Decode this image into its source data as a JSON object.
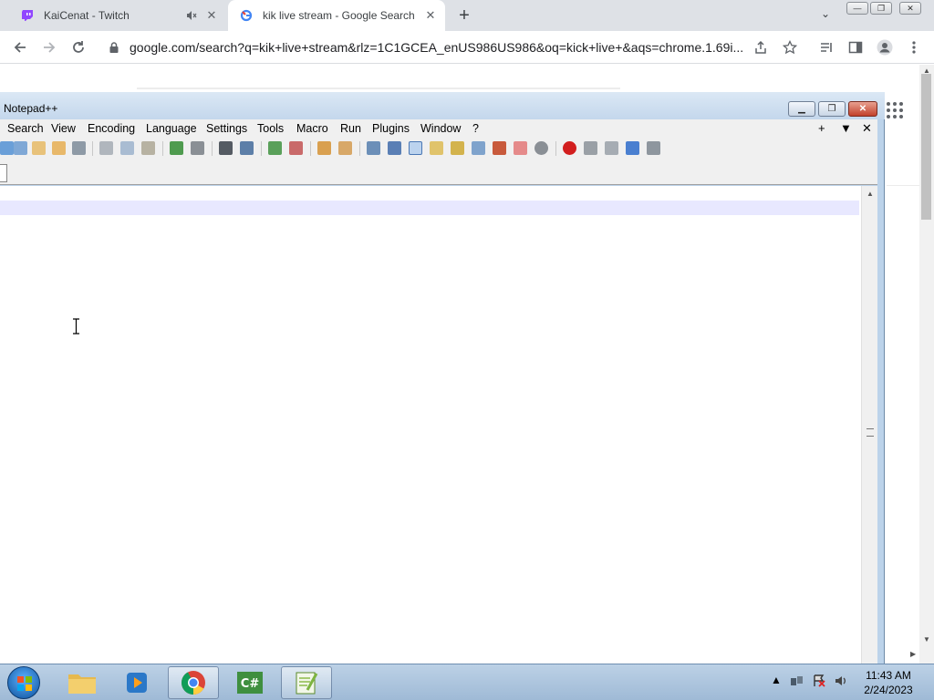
{
  "browser": {
    "tabs": [
      {
        "title": "KaiCenat - Twitch",
        "favicon": "twitch-icon",
        "muted": true
      },
      {
        "title": "kik live stream - Google Search",
        "favicon": "google-icon",
        "active": true
      }
    ],
    "new_tab": "+",
    "tab_close": "✕",
    "url": "google.com/search?q=kik+live+stream&rlz=1C1GCEA_enUS986US986&oq=kick+live+&aqs=chrome.1.69i..."
  },
  "notepadpp": {
    "title": "Notepad++",
    "menu": [
      "Search",
      "View",
      "Encoding",
      "Language",
      "Settings",
      "Tools",
      "Macro",
      "Run",
      "Plugins",
      "Window",
      "?"
    ],
    "menu_right": [
      "+",
      "▼",
      "✕"
    ]
  },
  "taskbar": {
    "apps": [
      "file-explorer-icon",
      "media-player-icon",
      "chrome-icon",
      "csharp-icon",
      "notepadpp-icon"
    ],
    "clock": {
      "time": "11:43 AM",
      "date": "2/24/2023"
    }
  },
  "colors": {
    "tab_strip": "#dee1e6",
    "npp_frame": "#bcd3ea",
    "current_line": "#e8e8ff",
    "taskbar": "#a9c3dd"
  }
}
